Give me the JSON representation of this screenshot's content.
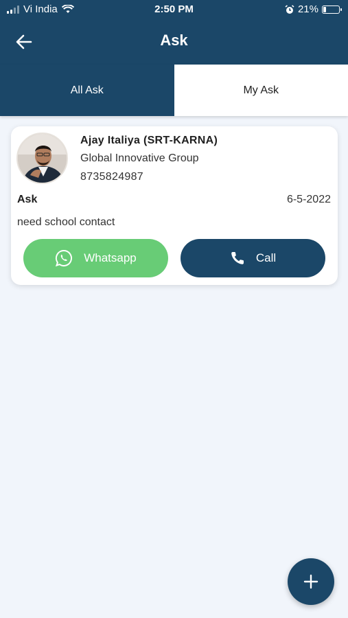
{
  "status_bar": {
    "carrier": "Vi India",
    "time": "2:50 PM",
    "battery": "21%",
    "battery_level": 0.21,
    "icons": [
      "signal-icon",
      "wifi-icon",
      "alarm-icon",
      "battery-icon"
    ]
  },
  "header": {
    "title": "Ask",
    "back_icon": "arrow-left-icon"
  },
  "tabs": [
    {
      "label": "All Ask",
      "selected": true
    },
    {
      "label": "My Ask",
      "selected": false
    }
  ],
  "asks": [
    {
      "name": "Ajay Italiya (SRT-KARNA)",
      "company": "Global Innovative Group",
      "phone": "8735824987",
      "label": "Ask",
      "date": "6-5-2022",
      "text": "need school contact",
      "whatsapp_label": "Whatsapp",
      "call_label": "Call"
    }
  ],
  "fab": {
    "icon": "plus-icon"
  },
  "colors": {
    "primary": "#1b4768",
    "whatsapp": "#68cc76",
    "background": "#f1f5fb"
  }
}
